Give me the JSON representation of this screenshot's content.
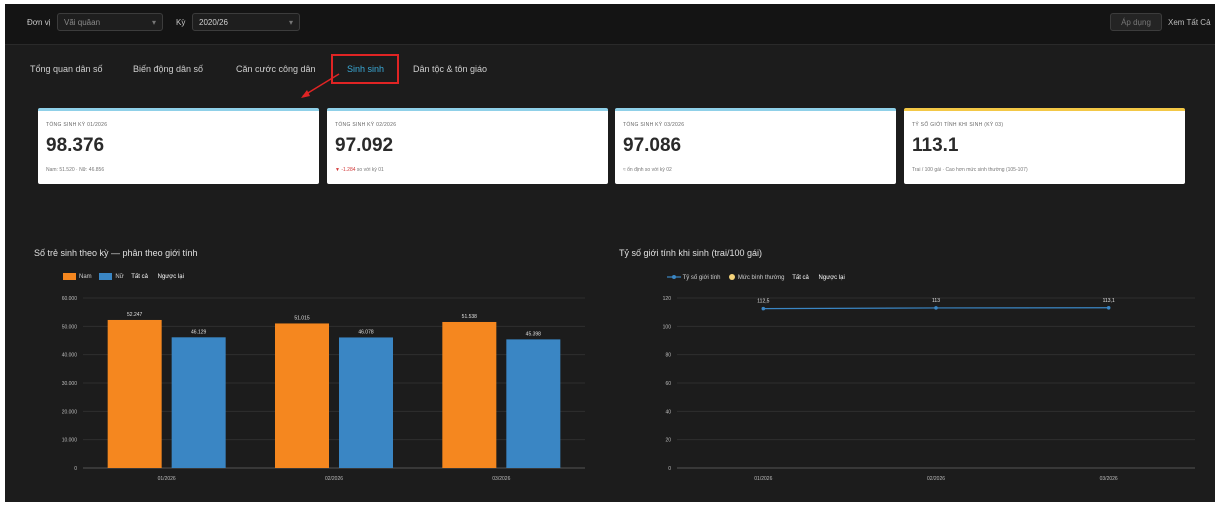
{
  "topbar": {
    "period_label": "Đơn vị",
    "unit_value": "Vãi quâan",
    "ky_label": "Kỳ",
    "ky_value": "2020/26",
    "export_btn": "Áp dụng",
    "link": "Xem Tất Cả"
  },
  "tabs": [
    {
      "label": "Tổng quan dân số",
      "active": false
    },
    {
      "label": "Biến động dân số",
      "active": false
    },
    {
      "label": "Căn cước công dân",
      "active": false
    },
    {
      "label": "Sinh sinh",
      "active": true
    },
    {
      "label": "Dân tộc & tôn giáo",
      "active": false
    }
  ],
  "cards": [
    {
      "title": "TỔNG SINH KỲ 01/2026",
      "value": "98.376",
      "sub": "Nam: 51.520 · Nữ: 46.856",
      "sub_trend": ""
    },
    {
      "title": "TỔNG SINH KỲ 02/2026",
      "value": "97.092",
      "sub": "so với kỳ 01",
      "sub_trend": "▼ -1.284"
    },
    {
      "title": "TỔNG SINH KỲ 03/2026",
      "value": "97.086",
      "sub": "≈ ổn định so với kỳ 02",
      "sub_trend": ""
    },
    {
      "title": "TỶ SỐ GIỚI TÍNH KHI SINH (KỲ 03)",
      "value": "113.1",
      "sub": "Trai / 100 gái · Cao hơn mức sinh thường (105-107)",
      "sub_trend": ""
    }
  ],
  "colors": {
    "male": "#f5871f",
    "female": "#3a86c4",
    "ratio_line": "#3a86c4",
    "normal_marker": "#f5d37a"
  },
  "chart_data": [
    {
      "type": "bar",
      "title": "Số trẻ sinh theo kỳ — phân theo giới tính",
      "categories": [
        "01/2026",
        "02/2026",
        "03/2026"
      ],
      "series": [
        {
          "name": "Nam",
          "values": [
            52247,
            51015,
            51538
          ]
        },
        {
          "name": "Nữ",
          "values": [
            46129,
            46078,
            45398
          ]
        }
      ],
      "legend_extra": [
        "Tất cả",
        "Ngược lại"
      ],
      "ylim": [
        0,
        60000
      ],
      "yticks": [
        0,
        10000,
        20000,
        30000,
        40000,
        50000,
        60000
      ],
      "ytick_labels": [
        "0",
        "10.000",
        "20.000",
        "30.000",
        "40.000",
        "50.000",
        "60.000"
      ]
    },
    {
      "type": "line",
      "title": "Tỷ số giới tính khi sinh (trai/100 gái)",
      "categories": [
        "01/2026",
        "02/2026",
        "03/2026"
      ],
      "series": [
        {
          "name": "Tỷ số giới tính",
          "values": [
            112.5,
            113,
            113.1
          ]
        },
        {
          "name": "Mức bình thường",
          "values": []
        }
      ],
      "data_labels": [
        "112,5",
        "113",
        "113,1"
      ],
      "legend_extra": [
        "Tất cả",
        "Ngược lại"
      ],
      "ylim": [
        0,
        120
      ],
      "yticks": [
        0,
        20,
        40,
        60,
        80,
        100,
        120
      ],
      "ytick_labels": [
        "0",
        "20",
        "40",
        "60",
        "80",
        "100",
        "120"
      ]
    }
  ]
}
